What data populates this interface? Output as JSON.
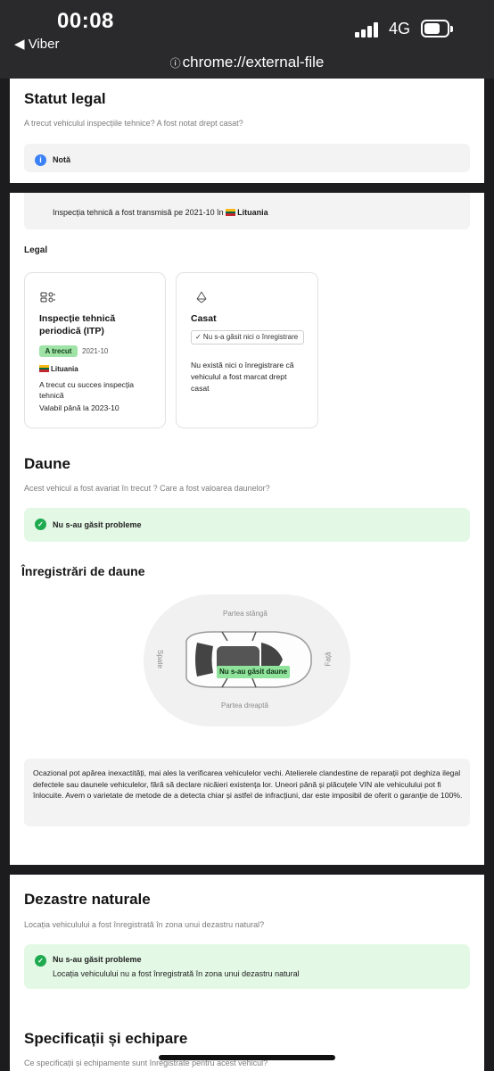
{
  "status_bar": {
    "time": "00:08",
    "back_app": "◀ Viber",
    "network": "4G",
    "signal_level": "4 of 4 bars"
  },
  "browser": {
    "url": "chrome://external-file"
  },
  "legal_status": {
    "title": "Statut legal",
    "subtitle": "A trecut vehiculul inspecțiile tehnice? A fost notat drept casat?",
    "note_label": "Notă"
  },
  "note_text": {
    "prefix": "Inspecția tehnică a fost transmisă pe 2021-10 în",
    "country": "Lituania"
  },
  "legal": {
    "heading": "Legal",
    "itp_card": {
      "title": "Inspecție tehnică periodică (ITP)",
      "badge": "A trecut",
      "date": "2021-10",
      "country": "Lituania",
      "description": "A trecut cu succes inspecția tehnică",
      "valid_until": "Valabil până la 2023-10"
    },
    "scrapped_card": {
      "title": "Casat",
      "tag": "✓ Nu s-a găsit nici o înregistrare",
      "description": "Nu există nici o înregistrare că vehiculul a fost marcat drept casat"
    }
  },
  "damages": {
    "title": "Daune",
    "subtitle": "Acest vehicul a fost avariat în trecut ? Care a fost valoarea daunelor?",
    "status": "Nu s-au găsit probleme",
    "records_title": "Înregistrări de daune",
    "car_labels": {
      "left": "Partea stângă",
      "right": "Partea dreaptă",
      "rear": "Spate",
      "front": "Față",
      "center": "Nu s-au găsit daune"
    },
    "disclaimer": "Ocazional pot apărea inexactități, mai ales la verificarea vehiculelor vechi. Atelierele clandestine de reparații pot deghiza ilegal defectele sau daunele vehiculelor, fără să declare nicăieri existența lor. Uneori până și plăcuțele VIN ale vehiculului pot fi înlocuite. Avem o varietate de metode de a detecta chiar și astfel de infracțiuni, dar este imposibil de oferit o garanție de 100%."
  },
  "natural_disasters": {
    "title": "Dezastre naturale",
    "subtitle": "Locația vehiculului a fost înregistrată în zona unui dezastru natural?",
    "status": "Nu s-au găsit probleme",
    "detail": "Locația vehiculului nu a fost înregistrată în zona unui dezastru natural"
  },
  "specs": {
    "title": "Specificații și echipare",
    "subtitle": "Ce specificații și echipamente sunt înregistrate pentru acest vehicul?"
  },
  "colors": {
    "status_bar_bg": "#2a2a2c",
    "success_green": "#1faa50",
    "success_bg": "#e4f8e6",
    "badge_green": "#9fe3a6",
    "info_blue": "#3b82f6",
    "flag_lithuania": [
      "#fdb913",
      "#006a44",
      "#c1272d"
    ]
  },
  "icons": [
    "info-icon",
    "check-circle-icon",
    "inspection-icon",
    "recycle-icon",
    "flag-lithuania-icon",
    "battery-icon",
    "signal-icon"
  ]
}
